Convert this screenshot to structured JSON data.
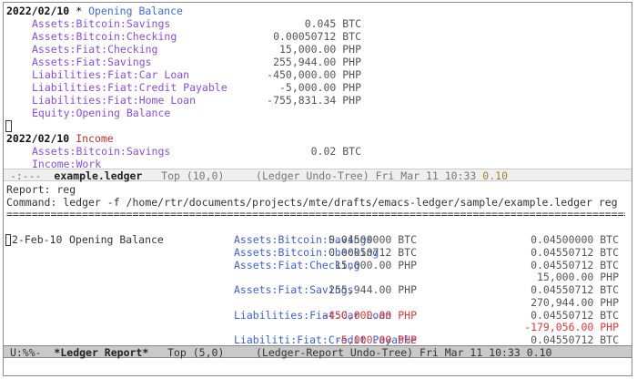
{
  "ledger_buffer": {
    "transactions": [
      {
        "date": "2022/02/10",
        "flag": "*",
        "payee": "Opening Balance",
        "postings": [
          {
            "account": "Assets:Bitcoin:Savings",
            "amount": "0.045 BTC"
          },
          {
            "account": "Assets:Bitcoin:Checking",
            "amount": "0.00050712 BTC"
          },
          {
            "account": "Assets:Fiat:Checking",
            "amount": "15,000.00 PHP"
          },
          {
            "account": "Assets:Fiat:Savings",
            "amount": "255,944.00 PHP"
          },
          {
            "account": "Liabilities:Fiat:Car Loan",
            "amount": "-450,000.00 PHP"
          },
          {
            "account": "Liabilities:Fiat:Credit Payable",
            "amount": "-5,000.00 PHP"
          },
          {
            "account": "Liabilities:Fiat:Home Loan",
            "amount": "-755,831.34 PHP"
          },
          {
            "account": "Equity:Opening Balance",
            "amount": ""
          }
        ]
      },
      {
        "date": "2022/02/10",
        "flag": "",
        "payee": "Income",
        "postings": [
          {
            "account": "Assets:Bitcoin:Savings",
            "amount": "0.02 BTC"
          },
          {
            "account": "Income:Work",
            "amount": ""
          }
        ]
      }
    ],
    "modeline": {
      "state": "-:---",
      "buffer": "example.ledger",
      "position": "Top (10,0)",
      "mode": "(Ledger Undo-Tree)",
      "datetime": "Fri Mar 11 10:33",
      "load": "0.10"
    }
  },
  "report_buffer": {
    "report_line": "Report: reg",
    "command_line": "Command: ledger -f /home/rtr/documents/projects/mte/drafts/emacs-ledger/sample/example.ledger reg",
    "separator": "===================================================================================================",
    "rows": [
      {
        "date": "2-Feb-10",
        "desc": "Opening Balance",
        "account": "Assets:Bitcoin:Savings",
        "amount": "0.04500000 BTC",
        "total": "0.04500000 BTC",
        "negative": false
      },
      {
        "date": "",
        "desc": "",
        "account": "Assets:Bitcoin:Checking",
        "amount": "0.00050712 BTC",
        "total": "0.04550712 BTC",
        "negative": false
      },
      {
        "date": "",
        "desc": "",
        "account": "Assets:Fiat:Checking",
        "amount": "15,000.00 PHP",
        "total": "0.04550712 BTC",
        "negative": false
      },
      {
        "date": "",
        "desc": "",
        "account": "",
        "amount": "",
        "total": "15,000.00 PHP",
        "negative": false
      },
      {
        "date": "",
        "desc": "",
        "account": "Assets:Fiat:Savings",
        "amount": "255,944.00 PHP",
        "total": "0.04550712 BTC",
        "negative": false
      },
      {
        "date": "",
        "desc": "",
        "account": "",
        "amount": "",
        "total": "270,944.00 PHP",
        "negative": false
      },
      {
        "date": "",
        "desc": "",
        "account": "Liabilities:Fiat:Car Loan",
        "amount": "-450,000.00 PHP",
        "total": "0.04550712 BTC",
        "negative": true
      },
      {
        "date": "",
        "desc": "",
        "account": "",
        "amount": "",
        "total": "-179,056.00 PHP",
        "negative": true
      },
      {
        "date": "",
        "desc": "",
        "account": "Liabiliti:Fiat:Credit Payable",
        "amount": "-5,000.00 PHP",
        "total": "0.04550712 BTC",
        "negative": true
      }
    ],
    "modeline": {
      "state": "U:%%-",
      "buffer": "*Ledger Report*",
      "position": "Top (5,0)",
      "mode": "(Ledger-Report Undo-Tree)",
      "datetime": "Fri Mar 11 10:33",
      "load": "0.10"
    }
  }
}
